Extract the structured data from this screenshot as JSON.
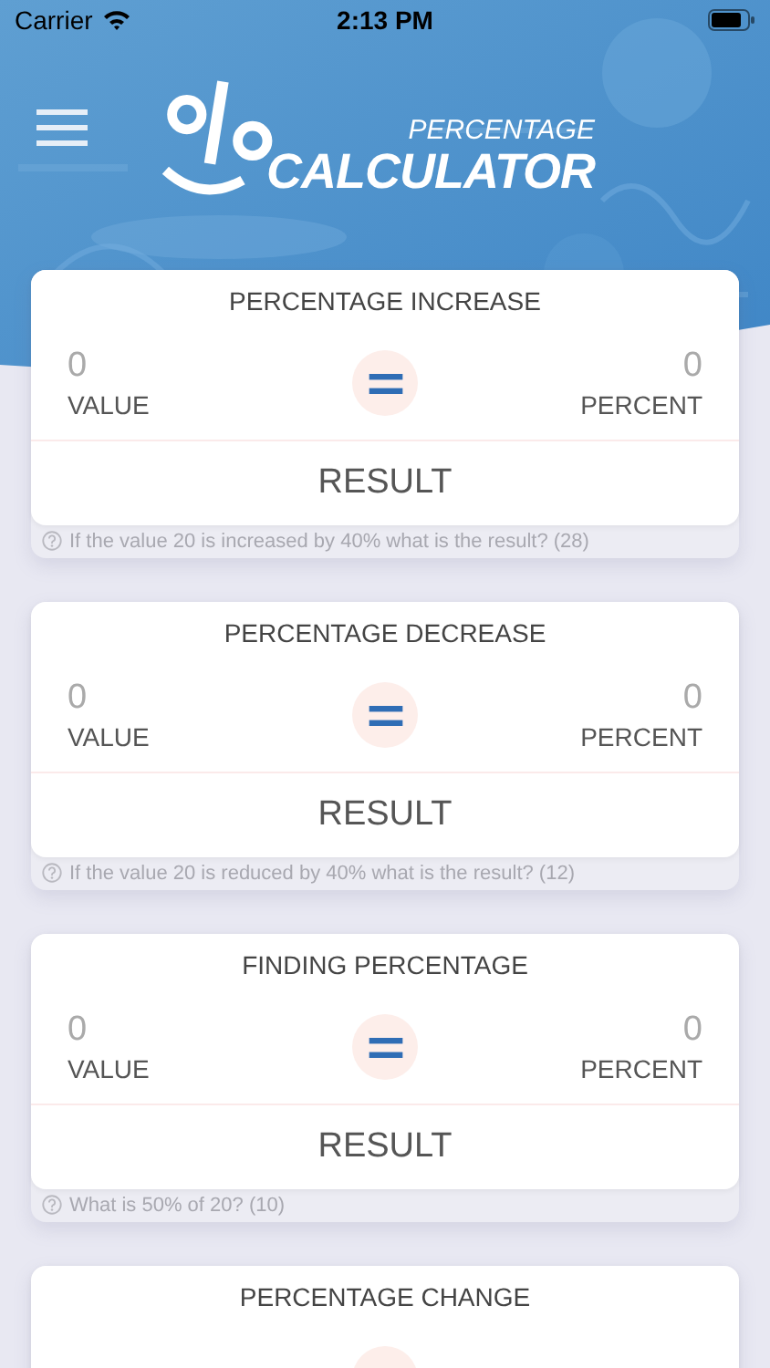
{
  "status_bar": {
    "carrier": "Carrier",
    "time": "2:13 PM"
  },
  "logo": {
    "line1": "PERCENTAGE",
    "line2": "CALCULATOR"
  },
  "cards": [
    {
      "title": "PERCENTAGE INCREASE",
      "value": {
        "placeholder": "0",
        "label": "VALUE"
      },
      "percent": {
        "placeholder": "0",
        "label": "PERCENT"
      },
      "result": "RESULT",
      "hint": "If the value 20 is increased by 40% what is the result? (28)"
    },
    {
      "title": "PERCENTAGE DECREASE",
      "value": {
        "placeholder": "0",
        "label": "VALUE"
      },
      "percent": {
        "placeholder": "0",
        "label": "PERCENT"
      },
      "result": "RESULT",
      "hint": "If the value 20 is reduced by 40% what is the result? (12)"
    },
    {
      "title": "FINDING PERCENTAGE",
      "value": {
        "placeholder": "0",
        "label": "VALUE"
      },
      "percent": {
        "placeholder": "0",
        "label": "PERCENT"
      },
      "result": "RESULT",
      "hint": "What is 50% of 20? (10)"
    },
    {
      "title": "PERCENTAGE CHANGE"
    }
  ]
}
